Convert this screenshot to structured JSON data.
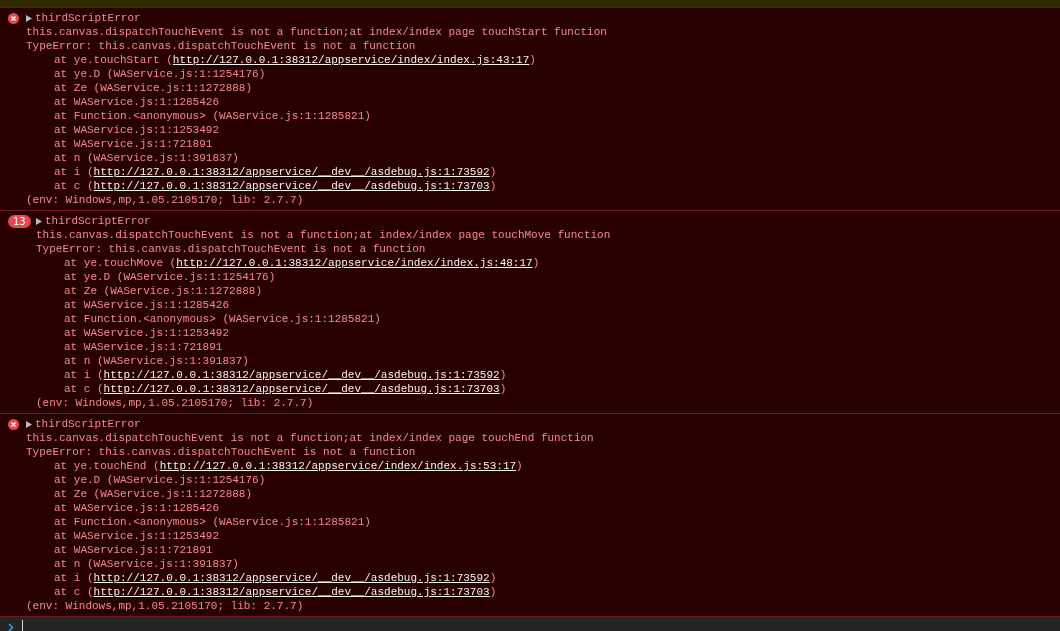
{
  "messages": [
    {
      "kind": "error",
      "expanded": false,
      "title": "thirdScriptError",
      "message": "this.canvas.dispatchTouchEvent is not a function;at index/index page touchStart function",
      "error": "TypeError: this.canvas.dispatchTouchEvent is not a function",
      "frames": [
        {
          "before": "at ye.touchStart (",
          "link": "http://127.0.0.1:38312/appservice/index/index.js:43:17",
          "after": ")"
        },
        {
          "before": "at ye.D (WAService.js:1:1254176)"
        },
        {
          "before": "at Ze (WAService.js:1:1272888)"
        },
        {
          "before": "at WAService.js:1:1285426"
        },
        {
          "before": "at Function.<anonymous> (WAService.js:1:1285821)"
        },
        {
          "before": "at WAService.js:1:1253492"
        },
        {
          "before": "at WAService.js:1:721891"
        },
        {
          "before": "at n (WAService.js:1:391837)"
        },
        {
          "before": "at i (",
          "link": "http://127.0.0.1:38312/appservice/__dev__/asdebug.js:1:73592",
          "after": ")"
        },
        {
          "before": "at c (",
          "link": "http://127.0.0.1:38312/appservice/__dev__/asdebug.js:1:73703",
          "after": ")"
        }
      ],
      "env": "(env: Windows,mp,1.05.2105170; lib: 2.7.7)"
    },
    {
      "kind": "count",
      "count": "13",
      "expanded": false,
      "title": "thirdScriptError",
      "message": "this.canvas.dispatchTouchEvent is not a function;at index/index page touchMove function",
      "error": "TypeError: this.canvas.dispatchTouchEvent is not a function",
      "frames": [
        {
          "before": "at ye.touchMove (",
          "link": "http://127.0.0.1:38312/appservice/index/index.js:48:17",
          "after": ")"
        },
        {
          "before": "at ye.D (WAService.js:1:1254176)"
        },
        {
          "before": "at Ze (WAService.js:1:1272888)"
        },
        {
          "before": "at WAService.js:1:1285426"
        },
        {
          "before": "at Function.<anonymous> (WAService.js:1:1285821)"
        },
        {
          "before": "at WAService.js:1:1253492"
        },
        {
          "before": "at WAService.js:1:721891"
        },
        {
          "before": "at n (WAService.js:1:391837)"
        },
        {
          "before": "at i (",
          "link": "http://127.0.0.1:38312/appservice/__dev__/asdebug.js:1:73592",
          "after": ")"
        },
        {
          "before": "at c (",
          "link": "http://127.0.0.1:38312/appservice/__dev__/asdebug.js:1:73703",
          "after": ")"
        }
      ],
      "env": "(env: Windows,mp,1.05.2105170; lib: 2.7.7)"
    },
    {
      "kind": "error",
      "expanded": false,
      "title": "thirdScriptError",
      "message": "this.canvas.dispatchTouchEvent is not a function;at index/index page touchEnd function",
      "error": "TypeError: this.canvas.dispatchTouchEvent is not a function",
      "frames": [
        {
          "before": "at ye.touchEnd (",
          "link": "http://127.0.0.1:38312/appservice/index/index.js:53:17",
          "after": ")"
        },
        {
          "before": "at ye.D (WAService.js:1:1254176)"
        },
        {
          "before": "at Ze (WAService.js:1:1272888)"
        },
        {
          "before": "at WAService.js:1:1285426"
        },
        {
          "before": "at Function.<anonymous> (WAService.js:1:1285821)"
        },
        {
          "before": "at WAService.js:1:1253492"
        },
        {
          "before": "at WAService.js:1:721891"
        },
        {
          "before": "at n (WAService.js:1:391837)"
        },
        {
          "before": "at i (",
          "link": "http://127.0.0.1:38312/appservice/__dev__/asdebug.js:1:73592",
          "after": ")"
        },
        {
          "before": "at c (",
          "link": "http://127.0.0.1:38312/appservice/__dev__/asdebug.js:1:73703",
          "after": ")"
        }
      ],
      "env": "(env: Windows,mp,1.05.2105170; lib: 2.7.7)"
    }
  ]
}
